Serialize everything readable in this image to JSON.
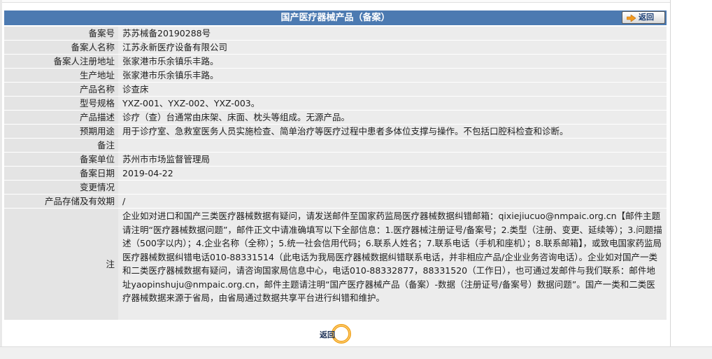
{
  "header": {
    "title": "国产医疗器械产品（备案）",
    "back_label": "返回"
  },
  "rows": [
    {
      "label": "备案号",
      "value": "苏苏械备20190288号"
    },
    {
      "label": "备案人名称",
      "value": "江苏永新医疗设备有限公司"
    },
    {
      "label": "备案人注册地址",
      "value": "张家港市乐余镇乐丰路。"
    },
    {
      "label": "生产地址",
      "value": "张家港市乐余镇乐丰路。"
    },
    {
      "label": "产品名称",
      "value": "诊查床"
    },
    {
      "label": "型号规格",
      "value": "YXZ-001、YXZ-002、YXZ-003。"
    },
    {
      "label": "产品描述",
      "value": "诊疗（查）台通常由床架、床面、枕头等组成。无源产品。"
    },
    {
      "label": "预期用途",
      "value": "用于诊疗室、急救室医务人员实施检查、简单治疗等医疗过程中患者多体位支撑与操作。不包括口腔科检查和诊断。"
    },
    {
      "label": "备注",
      "value": ""
    },
    {
      "label": "备案单位",
      "value": "苏州市市场监督管理局"
    },
    {
      "label": "备案日期",
      "value": "2019-04-22"
    },
    {
      "label": "变更情况",
      "value": ""
    },
    {
      "label": "产品存储及有效期",
      "value": "/"
    }
  ],
  "note": {
    "label": "注",
    "text": "企业如对进口和国产三类医疗器械数据有疑问，请发送邮件至国家药监局医疗器械数据纠错邮箱：qixiejiucuo@nmpaic.org.cn【邮件主题请注明“医疗器械数据问题”，邮件正文中请准确填写以下全部信息：1.医疗器械注册证号/备案号；2.类型（注册、变更、延续等）；3.问题描述（500字以内）；4.企业名称（全称）；5.统一社会信用代码；6.联系人姓名；7.联系电话（手机和座机）；8.联系邮箱】，或致电国家药监局医疗器械数据纠错电话010-88331514（此电话为我局医疗器械数据纠错联系电话，并非相应产品/企业业务咨询电话）。企业如对国产一类和二类医疗器械数据有疑问，请咨询国家局信息中心，电话010-88332877，88331520（工作日），也可通过发邮件与我们联系：邮件地址yaopinshuju@nmpaic.org.cn，邮件主题请注明“国产医疗器械产品（备案）-数据（注册证号/备案号）数据问题”。国产一类和二类医疗器械数据来源于省局，由省局通过数据共享平台进行纠错和维护。"
  },
  "footer": {
    "back_label": "返回"
  },
  "colors": {
    "header_bg": "#4c7ab1",
    "label_bg": "#e4e4e4",
    "value_bg": "#ececec",
    "arrow_icon": "#f29a1f"
  },
  "icons": {
    "top_back": "right-arrow-icon",
    "bottom_back": "orange-ring-icon"
  }
}
